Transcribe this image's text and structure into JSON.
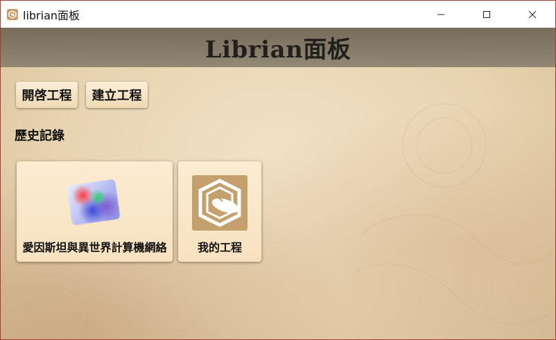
{
  "window": {
    "title": "librian面板",
    "icon": "librian-app-icon",
    "controls": {
      "minimize": "─",
      "maximize": "☐",
      "close": "✕"
    }
  },
  "header": {
    "title": "Librian面板"
  },
  "toolbar": {
    "open_label": "開啓工程",
    "create_label": "建立工程"
  },
  "history": {
    "title": "歷史記錄",
    "items": [
      {
        "label": "愛因斯坦與異世界計算機網絡",
        "icon": "project-thumbnail"
      },
      {
        "label": "我的工程",
        "icon": "librian-logo-icon"
      }
    ]
  },
  "colors": {
    "header_band": "#7a6f5e",
    "button_bg": "#f5e2c2",
    "logo_bg": "#c4a06c",
    "window_border": "#a33a2e"
  }
}
